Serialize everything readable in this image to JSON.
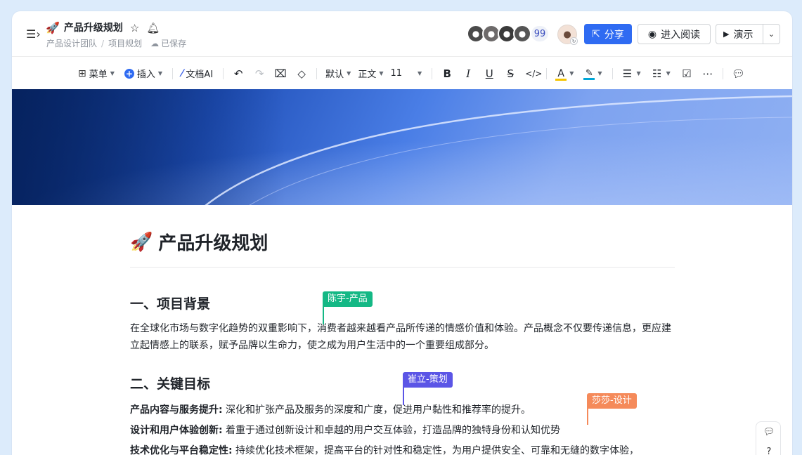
{
  "header": {
    "title_emoji": "🚀",
    "title": "产品升级规划",
    "breadcrumb": [
      "产品设计团队",
      "项目规划"
    ],
    "breadcrumb_sep": "/",
    "saved_status": "已保存",
    "collaborator_count": "99",
    "share_label": "分享",
    "read_label": "进入阅读",
    "present_label": "演示"
  },
  "toolbar": {
    "menu_label": "菜单",
    "insert_label": "插入",
    "ai_label": "文档AI",
    "style_default": "默认",
    "style_body": "正文",
    "font_size": "11"
  },
  "doc": {
    "title_emoji": "🚀",
    "title": "产品升级规划",
    "section1_heading": "一、项目背景",
    "section1_para": "在全球化市场与数字化趋势的双重影响下，消费者越来越看产品所传递的情感价值和体验。产品概念不仅要传递信息，更应建立起情感上的联系，赋予品牌以生命力，使之成为用户生活中的一个重要组成部分。",
    "section2_heading": "二、关键目标",
    "goals": [
      {
        "label": "产品内容与服务提升:",
        "text": " 深化和扩张产品及服务的深度和广度，促进用户黏性和推荐率的提升。"
      },
      {
        "label": "设计和用户体验创新:",
        "text": "  着重于通过创新设计和卓越的用户交互体验，打造品牌的独特身份和认知优势"
      },
      {
        "label": "技术优化与平台稳定性:",
        "text": "  持续优化技术框架，提高平台的针对性和稳定性，为用户提供安全、可靠和无缝的数字体验，"
      }
    ]
  },
  "collab_cursors": [
    {
      "name": "陈宇-产品",
      "color": "#14b885"
    },
    {
      "name": "崔立-策划",
      "color": "#5b55e6"
    },
    {
      "name": "莎莎-设计",
      "color": "#f58a5a"
    }
  ],
  "colors": {
    "accent": "#2f6bf2"
  }
}
